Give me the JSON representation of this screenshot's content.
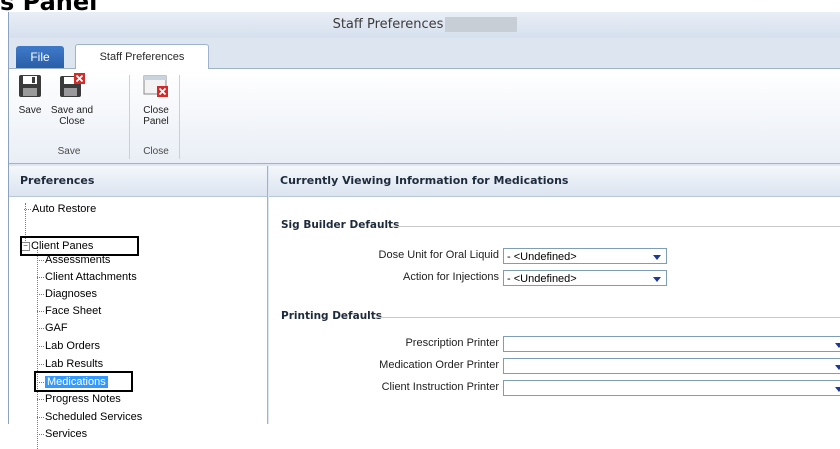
{
  "page_heading": "s Panel",
  "window": {
    "title": "Staff Preferences"
  },
  "tabs": {
    "file": "File",
    "staff_preferences": "Staff Preferences"
  },
  "ribbon": {
    "save": "Save",
    "save_and_close_line1": "Save and",
    "save_and_close_line2": "Close",
    "close_panel_line1": "Close",
    "close_panel_line2": "Panel",
    "group_save": "Save",
    "group_close": "Close"
  },
  "left_panel": {
    "header": "Preferences",
    "tree": {
      "auto_restore": "Auto Restore",
      "client_panes": "Client Panes",
      "children": [
        "Assessments",
        "Client Attachments",
        "Diagnoses",
        "Face Sheet",
        "GAF",
        "Lab Orders",
        "Lab Results",
        "Medications",
        "Progress Notes",
        "Scheduled Services",
        "Services"
      ]
    }
  },
  "right_panel": {
    "header": "Currently Viewing Information for Medications",
    "sig_builder": {
      "title": "Sig Builder Defaults",
      "dose_unit_label": "Dose Unit for Oral Liquid",
      "dose_unit_value": "- <Undefined>",
      "action_injections_label": "Action for Injections",
      "action_injections_value": "- <Undefined>"
    },
    "printing": {
      "title": "Printing Defaults",
      "prescription_label": "Prescription Printer",
      "prescription_value": "",
      "medication_order_label": "Medication Order Printer",
      "medication_order_value": "",
      "client_instruction_label": "Client Instruction Printer",
      "client_instruction_value": ""
    }
  },
  "colors": {
    "accent": "#2a5ea8",
    "selection": "#3399ff",
    "chrome": "#dde6f1"
  }
}
